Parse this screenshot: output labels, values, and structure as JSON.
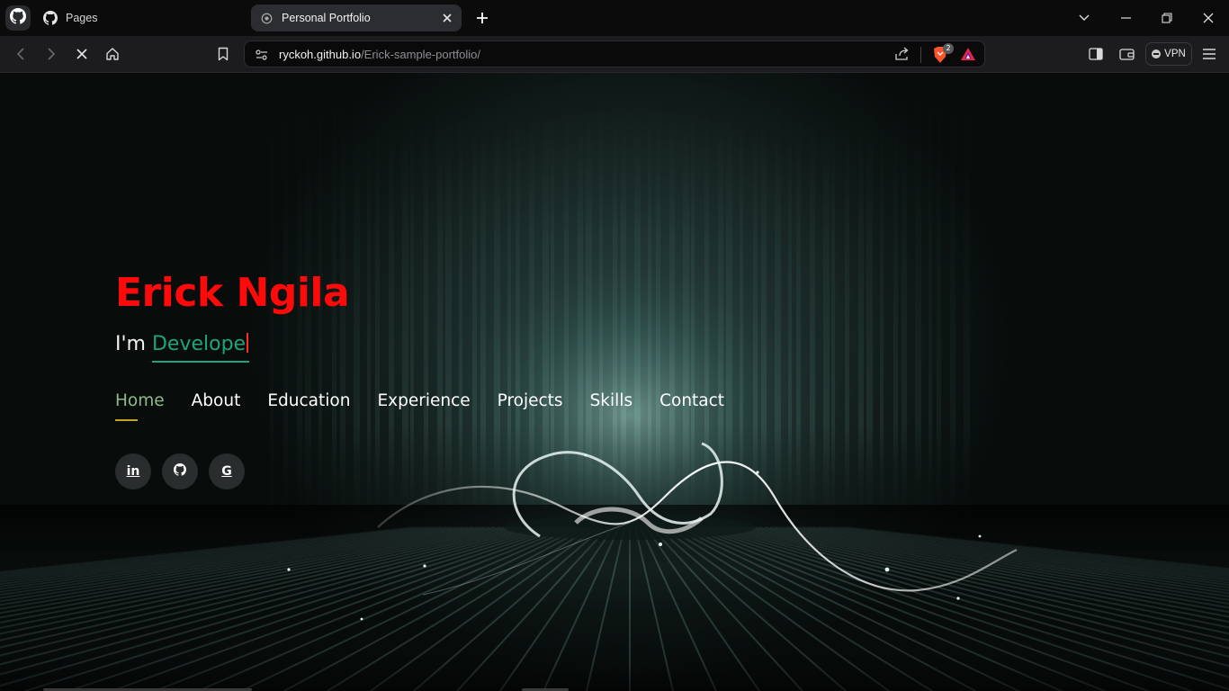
{
  "browser": {
    "tabs": [
      {
        "title": "Pages",
        "favicon": "github-icon",
        "active": false
      },
      {
        "title": "Personal Portfolio",
        "favicon": "globe-icon",
        "active": true
      }
    ],
    "url": {
      "host": "ryckoh.github.io",
      "path": "/Erick-sample-portfolio/"
    },
    "vpn_label": "VPN",
    "brave_badge": "2"
  },
  "hero": {
    "name": "Erick Ngila",
    "prefix": "I'm ",
    "typed_word": "Develope",
    "name_color": "#ff0a0a",
    "typed_color": "#1fa37e"
  },
  "nav": {
    "items": [
      "Home",
      "About",
      "Education",
      "Experience",
      "Projects",
      "Skills",
      "Contact"
    ],
    "active": "Home"
  },
  "socials": [
    {
      "name": "linkedin",
      "glyph": "in"
    },
    {
      "name": "github",
      "glyph": "github-icon"
    },
    {
      "name": "google",
      "glyph": "G"
    }
  ]
}
